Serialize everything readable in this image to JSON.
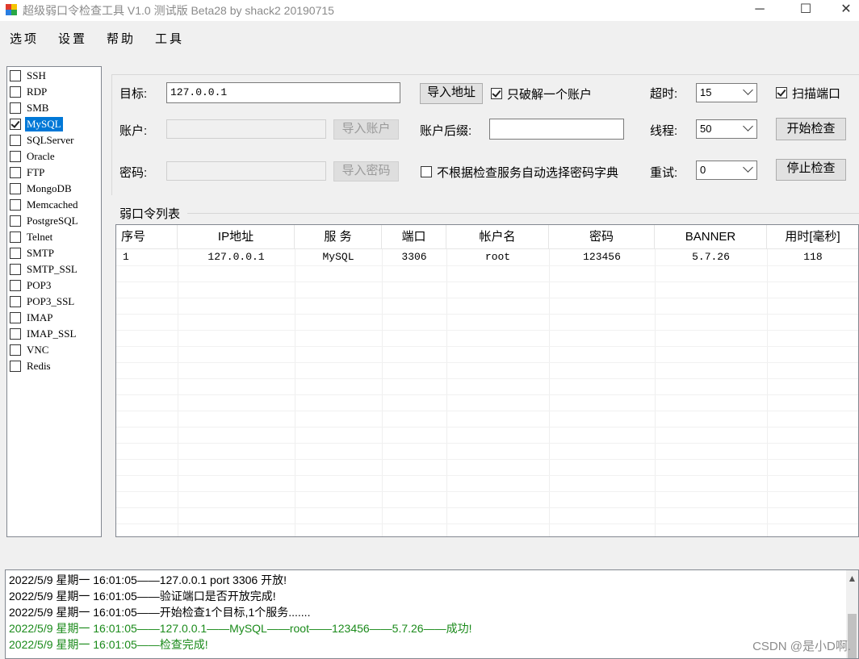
{
  "window": {
    "title": "超级弱口令检查工具 V1.0 测试版 Beta28 by shack2 20190715",
    "minimize_glyph": "─",
    "maximize_glyph": "☐",
    "close_glyph": "✕"
  },
  "menu": [
    "选项",
    "设置",
    "帮助",
    "工具"
  ],
  "services": [
    {
      "label": "SSH",
      "checked": false,
      "selected": false
    },
    {
      "label": "RDP",
      "checked": false,
      "selected": false
    },
    {
      "label": "SMB",
      "checked": false,
      "selected": false
    },
    {
      "label": "MySQL",
      "checked": true,
      "selected": true
    },
    {
      "label": "SQLServer",
      "checked": false,
      "selected": false
    },
    {
      "label": "Oracle",
      "checked": false,
      "selected": false
    },
    {
      "label": "FTP",
      "checked": false,
      "selected": false
    },
    {
      "label": "MongoDB",
      "checked": false,
      "selected": false
    },
    {
      "label": "Memcached",
      "checked": false,
      "selected": false
    },
    {
      "label": "PostgreSQL",
      "checked": false,
      "selected": false
    },
    {
      "label": "Telnet",
      "checked": false,
      "selected": false
    },
    {
      "label": "SMTP",
      "checked": false,
      "selected": false
    },
    {
      "label": "SMTP_SSL",
      "checked": false,
      "selected": false
    },
    {
      "label": "POP3",
      "checked": false,
      "selected": false
    },
    {
      "label": "POP3_SSL",
      "checked": false,
      "selected": false
    },
    {
      "label": "IMAP",
      "checked": false,
      "selected": false
    },
    {
      "label": "IMAP_SSL",
      "checked": false,
      "selected": false
    },
    {
      "label": "VNC",
      "checked": false,
      "selected": false
    },
    {
      "label": "Redis",
      "checked": false,
      "selected": false
    }
  ],
  "form": {
    "target_label": "目标:",
    "target_value": "127.0.0.1",
    "import_address_button": "导入地址",
    "only_one_account_label": "只破解一个账户",
    "only_one_account_checked": true,
    "timeout_label": "超时:",
    "timeout_value": "15",
    "scan_port_label": "扫描端口",
    "scan_port_checked": true,
    "account_label": "账户:",
    "account_value": "",
    "import_account_button": "导入账户",
    "account_suffix_label": "账户后缀:",
    "account_suffix_value": "",
    "threads_label": "线程:",
    "threads_value": "50",
    "start_button": "开始检查",
    "password_label": "密码:",
    "password_value": "",
    "import_password_button": "导入密码",
    "auto_dict_label": "不根据检查服务自动选择密码字典",
    "auto_dict_checked": false,
    "retry_label": "重试:",
    "retry_value": "0",
    "stop_button": "停止检查"
  },
  "results": {
    "group_title": "弱口令列表",
    "columns": [
      "序号",
      "IP地址",
      "服 务",
      "端口",
      "帐户名",
      "密码",
      "BANNER",
      "用时[毫秒]"
    ],
    "rows": [
      [
        "1",
        "127.0.0.1",
        "MySQL",
        "3306",
        "root",
        "123456",
        "5.7.26",
        "118"
      ]
    ]
  },
  "log": [
    {
      "text": "2022/5/9 星期一 16:01:05——127.0.0.1 port 3306 开放!",
      "status": "info"
    },
    {
      "text": "2022/5/9 星期一 16:01:05——验证端口是否开放完成!",
      "status": "info"
    },
    {
      "text": "2022/5/9 星期一 16:01:05——开始检查1个目标,1个服务.......",
      "status": "info"
    },
    {
      "text": "2022/5/9 星期一 16:01:05——127.0.0.1——MySQL——root——123456——5.7.26——成功!",
      "status": "success"
    },
    {
      "text": "2022/5/9 星期一 16:01:05——检查完成!",
      "status": "success"
    }
  ],
  "watermark": "CSDN @是小D啊.",
  "colors": {
    "selection": "#0078d7",
    "success_text": "#1a8a1a"
  }
}
